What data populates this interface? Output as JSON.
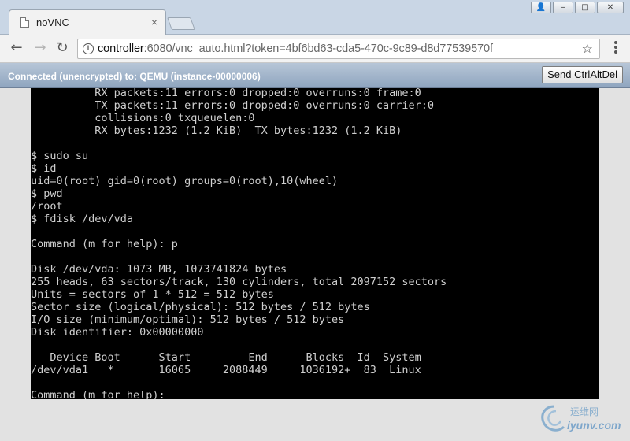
{
  "browser": {
    "tab_title": "noVNC",
    "tab_close": "×",
    "url_host": "controller",
    "url_rest": ":6080/vnc_auto.html?token=4bf6bd63-cda5-470c-9c89-d8d77539570f",
    "page_icon": "i",
    "back_icon": "←",
    "forward_icon": "→",
    "reload_icon": "↻",
    "star_icon": "☆",
    "window_buttons": {
      "user": "👤",
      "minimize": "–",
      "maximize": "□",
      "close": "✕"
    }
  },
  "novnc": {
    "status": "Connected (unencrypted) to: QEMU (instance-00000006)",
    "send_cad_label": "Send CtrlAltDel"
  },
  "terminal": {
    "lines": [
      "          RX packets:11 errors:0 dropped:0 overruns:0 frame:0",
      "          TX packets:11 errors:0 dropped:0 overruns:0 carrier:0",
      "          collisions:0 txqueuelen:0",
      "          RX bytes:1232 (1.2 KiB)  TX bytes:1232 (1.2 KiB)",
      "",
      "$ sudo su",
      "$ id",
      "uid=0(root) gid=0(root) groups=0(root),10(wheel)",
      "$ pwd",
      "/root",
      "$ fdisk /dev/vda",
      "",
      "Command (m for help): p",
      "",
      "Disk /dev/vda: 1073 MB, 1073741824 bytes",
      "255 heads, 63 sectors/track, 130 cylinders, total 2097152 sectors",
      "Units = sectors of 1 * 512 = 512 bytes",
      "Sector size (logical/physical): 512 bytes / 512 bytes",
      "I/O size (minimum/optimal): 512 bytes / 512 bytes",
      "Disk identifier: 0x00000000",
      "",
      "   Device Boot      Start         End      Blocks  Id  System",
      "/dev/vda1   *       16065     2088449     1036192+  83  Linux",
      "",
      "Command (m for help): "
    ]
  },
  "watermark": {
    "cn": "运维网",
    "url": "iyunv.com"
  },
  "colors": {
    "terminal_bg": "#000000",
    "terminal_fg": "#cfcfcf",
    "status_bar": "#8fa5bf"
  }
}
